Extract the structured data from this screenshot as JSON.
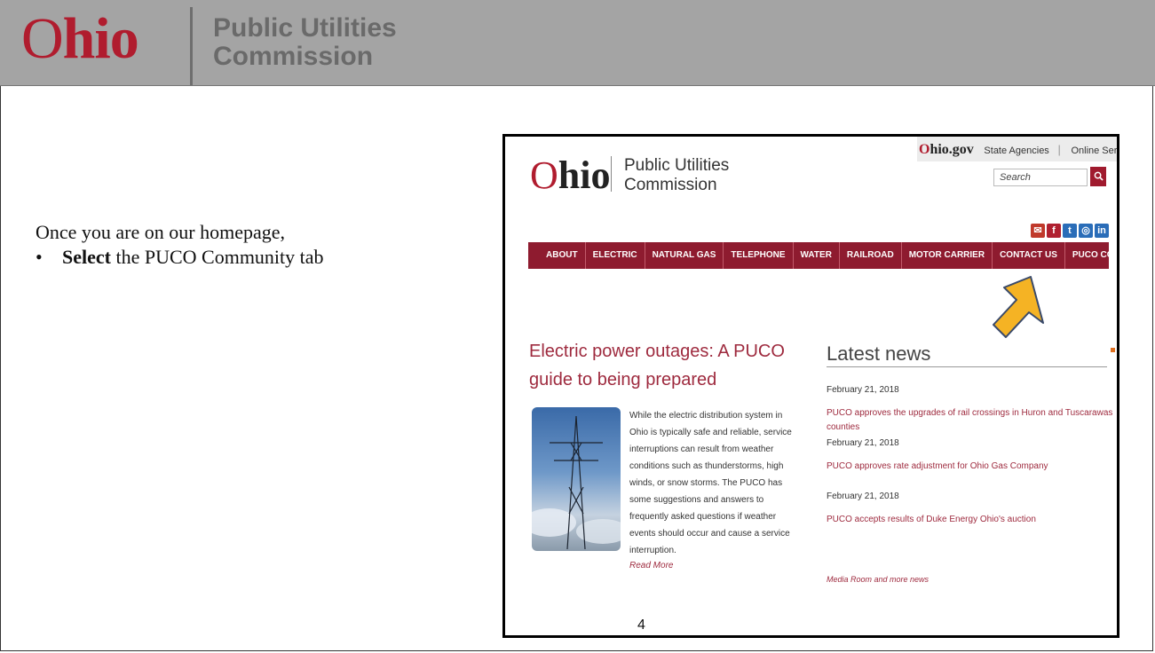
{
  "slide_header": {
    "logo_o": "O",
    "logo_rest": "hio",
    "title_line1": "Public Utilities",
    "title_line2": "Commission"
  },
  "instruction": {
    "intro": "Once you are on our homepage,",
    "bullet_symbol": "•",
    "bullet_bold": "Select",
    "bullet_rest": " the PUCO Community tab"
  },
  "screenshot": {
    "ohio_gov_o": "O",
    "ohio_gov_rest": "hio.gov",
    "top_links": [
      "State Agencies",
      "Online Services"
    ],
    "site_logo_o": "O",
    "site_logo_rest": "hio",
    "site_title_line1": "Public Utilities",
    "site_title_line2": "Commission",
    "search_placeholder": "Search",
    "search_icon": "search-icon",
    "social_icons": [
      "email-icon",
      "facebook-icon",
      "twitter-icon",
      "instagram-icon",
      "linkedin-icon"
    ],
    "nav_items": [
      "ABOUT",
      "ELECTRIC",
      "NATURAL GAS",
      "TELEPHONE",
      "WATER",
      "RAILROAD",
      "MOTOR CARRIER",
      "CONTACT US",
      "PUCO COMMUNITY"
    ],
    "nav_color": "#8e1b2f",
    "arrow_color": "#f5b324",
    "lede": {
      "title": "Electric power outages: A PUCO guide to being prepared",
      "body": "While the electric distribution system in Ohio is typically safe and reliable, service interruptions can result from weather conditions such as thunderstorms, high winds, or snow storms. The PUCO has some suggestions and answers to frequently asked questions if weather events should occur and cause a service interruption.",
      "read_more": "Read More"
    },
    "latest_news": {
      "heading": "Latest news",
      "items": [
        {
          "date": "February 21, 2018",
          "headline": "PUCO approves the upgrades of rail crossings in Huron and Tuscarawas counties"
        },
        {
          "date": "February 21, 2018",
          "headline": "PUCO approves rate adjustment for Ohio Gas Company"
        },
        {
          "date": "February 21, 2018",
          "headline": "PUCO accepts results of Duke Energy Ohio's auction"
        }
      ],
      "more_link": "Media Room and more news"
    }
  },
  "page_number": "4"
}
